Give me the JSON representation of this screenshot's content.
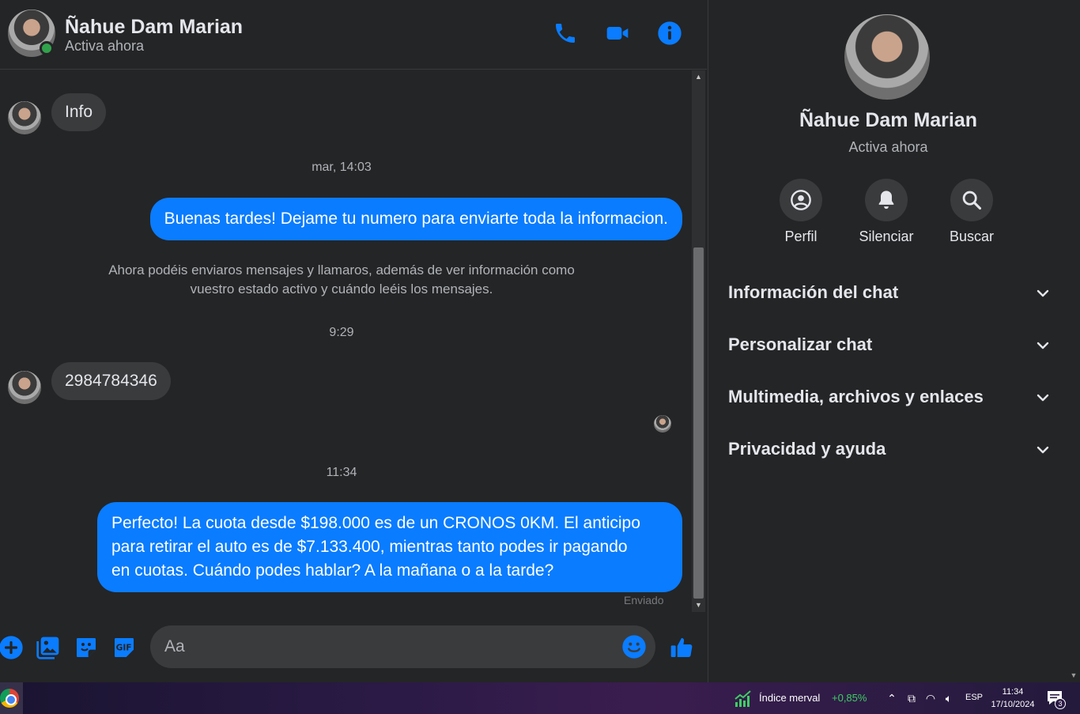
{
  "contact": {
    "name": "Ñahue Dam Marian",
    "status": "Activa ahora"
  },
  "messages": {
    "in_1": "Info",
    "ts_1": "mar, 14:03",
    "out_1": "Buenas tardes! Dejame tu numero para enviarte toda la informacion.",
    "notice_line1": "Ahora podéis enviaros mensajes y llamaros, además de ver información como",
    "notice_line2": "vuestro estado activo y cuándo leéis los mensajes.",
    "ts_2": "9:29",
    "in_2": "2984784346",
    "ts_3": "11:34",
    "out_2_line1": "Perfecto! La cuota desde $198.000 es de un CRONOS 0KM. El anticipo",
    "out_2_line2": "para retirar el auto es de $7.133.400, mientras tanto podes ir pagando",
    "out_2_line3": "en cuotas. Cuándo podes hablar? A la mañana o a la tarde?",
    "sent_label": "Enviado"
  },
  "composer": {
    "placeholder": "Aa"
  },
  "info_panel": {
    "actions": [
      {
        "label": "Perfil",
        "icon": "profile-icon"
      },
      {
        "label": "Silenciar",
        "icon": "bell-icon"
      },
      {
        "label": "Buscar",
        "icon": "search-icon"
      }
    ],
    "sections": [
      {
        "title": "Información del chat"
      },
      {
        "title": "Personalizar chat"
      },
      {
        "title": "Multimedia, archivos y enlaces"
      },
      {
        "title": "Privacidad y ayuda"
      }
    ]
  },
  "taskbar": {
    "widget_label": "Índice merval",
    "widget_value": "+0,85%",
    "language": "ESP",
    "time": "11:34",
    "date": "17/10/2024",
    "notification_count": "3"
  },
  "colors": {
    "accent": "#0a7cff",
    "background": "#242526",
    "bubble_in": "#3a3b3c",
    "online": "#31a24c"
  }
}
